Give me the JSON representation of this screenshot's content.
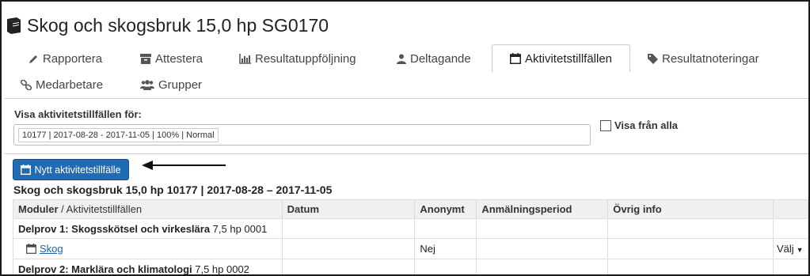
{
  "page": {
    "title": "Skog och skogsbruk 15,0 hp SG0170"
  },
  "tabs": [
    {
      "label": "Rapportera",
      "icon": "pencil-icon"
    },
    {
      "label": "Attestera",
      "icon": "archive-icon"
    },
    {
      "label": "Resultatuppföljning",
      "icon": "bar-chart-icon"
    },
    {
      "label": "Deltagande",
      "icon": "user-icon"
    },
    {
      "label": "Aktivitetstillfällen",
      "icon": "calendar-icon",
      "active": true
    },
    {
      "label": "Resultatnoteringar",
      "icon": "tag-icon"
    },
    {
      "label": "Medarbetare",
      "icon": "link-icon"
    },
    {
      "label": "Grupper",
      "icon": "users-icon"
    }
  ],
  "filter": {
    "label": "Visa aktivitetstillfällen för:",
    "selected": "10177 | 2017-08-28 - 2017-11-05 | 100% | Normal",
    "show_all_label": "Visa från alla",
    "show_all_checked": false
  },
  "new_button": {
    "label": "Nytt aktivitetstillfälle"
  },
  "course_heading": "Skog och skogsbruk 15,0 hp 10177 | 2017-08-28 – 2017-11-05",
  "table": {
    "headers": {
      "module_bold": "Moduler",
      "module_rest": " / Aktivitetstillfällen",
      "date": "Datum",
      "anonymous": "Anonymt",
      "registration": "Anmälningsperiod",
      "other": "Övrig info"
    },
    "rows": [
      {
        "type": "group",
        "name": "Delprov 1: Skogsskötsel och virkeslära",
        "meta": " 7,5 hp 0001"
      },
      {
        "type": "activity",
        "name": "Skog",
        "datum": "",
        "anonymt": "Nej",
        "period": "",
        "info": "",
        "action": "Välj"
      },
      {
        "type": "group",
        "name": "Delprov 2: Marklära och klimatologi",
        "meta": " 7,5 hp 0002"
      }
    ]
  },
  "colors": {
    "primary": "#1f6bb5",
    "link": "#1f5fa8",
    "header_bg": "#f0f0f0"
  }
}
